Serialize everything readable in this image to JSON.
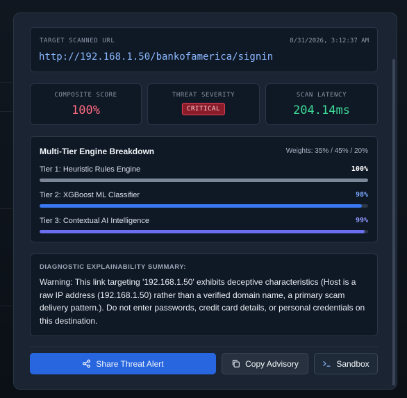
{
  "target": {
    "label": "TARGET SCANNED URL",
    "timestamp": "8/31/2026, 3:12:37 AM",
    "url": "http://192.168.1.50/bankofamerica/signin"
  },
  "metrics": {
    "composite": {
      "label": "COMPOSITE SCORE",
      "value": "100%"
    },
    "severity": {
      "label": "THREAT SEVERITY",
      "value": "CRITICAL"
    },
    "latency": {
      "label": "SCAN LATENCY",
      "value": "204.14ms"
    }
  },
  "engine": {
    "title": "Multi-Tier Engine Breakdown",
    "weights": "Weights: 35% / 45% / 20%",
    "tiers": [
      {
        "name": "Tier 1: Heuristic Rules Engine",
        "value_label": "100%",
        "fraction": 1.0,
        "color": "#7b8697",
        "label_color": "#ffffff"
      },
      {
        "name": "Tier 2: XGBoost ML Classifier",
        "value_label": "98%",
        "fraction": 0.98,
        "color": "#3a78f2",
        "label_color": "#7aa9ff"
      },
      {
        "name": "Tier 3: Contextual AI Intelligence",
        "value_label": "99%",
        "fraction": 0.99,
        "color": "#6a6ff0",
        "label_color": "#8f9bff"
      }
    ]
  },
  "diagnostic": {
    "heading": "DIAGNOSTIC EXPLAINABILITY SUMMARY:",
    "text": "Warning: This link targeting '192.168.1.50' exhibits deceptive characteristics (Host is a raw IP address (192.168.1.50) rather than a verified domain name, a primary scam delivery pattern.). Do not enter passwords, credit card details, or personal credentials on this destination."
  },
  "actions": {
    "share": {
      "label": "Share Threat Alert",
      "icon": "share-icon"
    },
    "copy": {
      "label": "Copy Advisory",
      "icon": "copy-icon"
    },
    "sandbox": {
      "label": "Sandbox",
      "icon": "terminal-icon"
    }
  },
  "colors": {
    "score": "#ff6b81",
    "latency": "#3ddc97",
    "accent": "#2866e0"
  }
}
